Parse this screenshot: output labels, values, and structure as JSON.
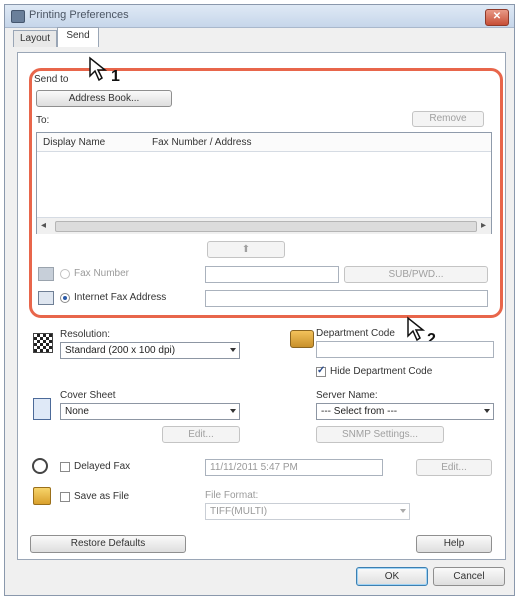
{
  "window": {
    "title": "Printing Preferences",
    "close_label": "✕"
  },
  "tabs": [
    {
      "label": "Layout"
    },
    {
      "label": "Send"
    }
  ],
  "send_to": {
    "group_label": "Send to",
    "address_book_button": "Address Book...",
    "to_label": "To:",
    "remove_button": "Remove",
    "columns": [
      "Display Name",
      "Fax Number / Address"
    ],
    "up_arrow": "⬆",
    "fax_number_label": "Fax Number",
    "sub_pwd_button": "SUB/PWD...",
    "internet_fax_label": "Internet Fax Address"
  },
  "resolution": {
    "label": "Resolution:",
    "value": "Standard (200 x 100 dpi)"
  },
  "department": {
    "label": "Department Code",
    "hide_label": "Hide Department Code",
    "hide_checked": true
  },
  "cover_sheet": {
    "label": "Cover Sheet",
    "value": "None",
    "edit_button": "Edit..."
  },
  "server": {
    "label": "Server Name:",
    "value": "--- Select from ---",
    "snmp_button": "SNMP Settings..."
  },
  "delayed_fax": {
    "label": "Delayed Fax",
    "value": "11/11/2011 5:47 PM",
    "edit_button": "Edit..."
  },
  "save_as_file": {
    "label": "Save as File",
    "format_label": "File Format:",
    "format_value": "TIFF(MULTI)"
  },
  "footer": {
    "restore_button": "Restore Defaults",
    "help_button": "Help",
    "ok_button": "OK",
    "cancel_button": "Cancel"
  },
  "callouts": {
    "one": "1",
    "two": "2"
  },
  "colors": {
    "highlight": "#e8664b",
    "titlebar": "#c6d6ea"
  }
}
